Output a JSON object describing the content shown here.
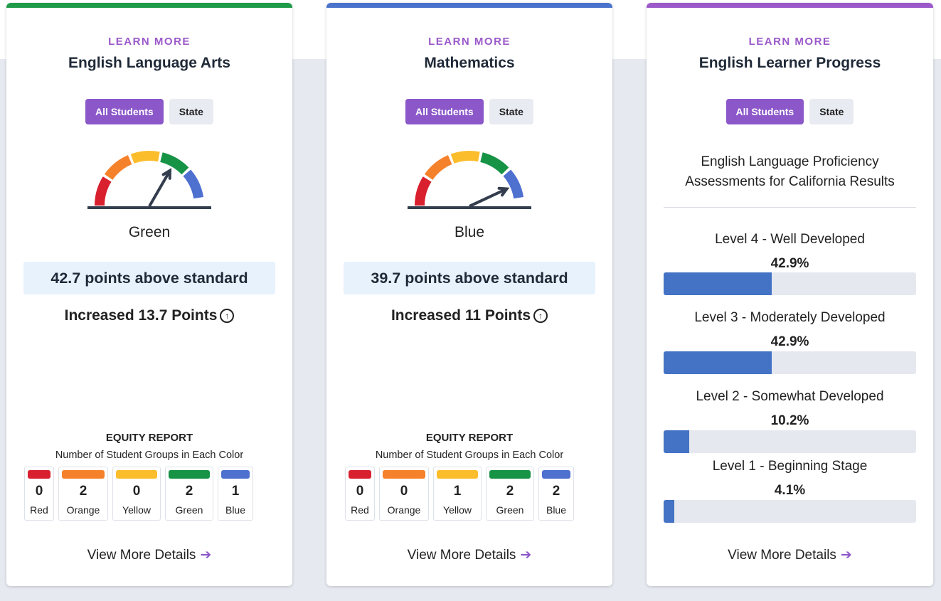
{
  "colors": {
    "ela_accent": "#1e9a48",
    "math_accent": "#4a73cc",
    "elp_accent": "#9b59c9",
    "toggle_active": "#8b57c9",
    "red": "#d8202f",
    "orange": "#f5822b",
    "yellow": "#fbbd2c",
    "green": "#179346",
    "blue": "#4e70cf",
    "progress_fill": "#4472c4"
  },
  "ela": {
    "learn_more": "LEARN MORE",
    "title": "English Language Arts",
    "toggle": {
      "active": "All Students",
      "inactive": "State"
    },
    "status": "Green",
    "gauge_level": "green",
    "points": "42.7 points above standard",
    "change": "Increased 13.7 Points",
    "equity": {
      "title": "EQUITY REPORT",
      "subtitle": "Number of Student Groups in Each Color",
      "cells": [
        {
          "count": "0",
          "label": "Red"
        },
        {
          "count": "2",
          "label": "Orange"
        },
        {
          "count": "0",
          "label": "Yellow"
        },
        {
          "count": "2",
          "label": "Green"
        },
        {
          "count": "1",
          "label": "Blue"
        }
      ]
    },
    "details_link": "View More Details"
  },
  "math": {
    "learn_more": "LEARN MORE",
    "title": "Mathematics",
    "toggle": {
      "active": "All Students",
      "inactive": "State"
    },
    "status": "Blue",
    "gauge_level": "blue",
    "points": "39.7 points above standard",
    "change": "Increased 11 Points",
    "equity": {
      "title": "EQUITY REPORT",
      "subtitle": "Number of Student Groups in Each Color",
      "cells": [
        {
          "count": "0",
          "label": "Red"
        },
        {
          "count": "0",
          "label": "Orange"
        },
        {
          "count": "1",
          "label": "Yellow"
        },
        {
          "count": "2",
          "label": "Green"
        },
        {
          "count": "2",
          "label": "Blue"
        }
      ]
    },
    "details_link": "View More Details"
  },
  "elp": {
    "learn_more": "LEARN MORE",
    "title": "English Learner Progress",
    "toggle": {
      "active": "All Students",
      "inactive": "State"
    },
    "subtitle_line1": "English Language Proficiency",
    "subtitle_line2": "Assessments for California Results",
    "levels": [
      {
        "label": "Level 4 - Well Developed",
        "pct": "42.9%",
        "value": 42.9
      },
      {
        "label": "Level 3 - Moderately Developed",
        "pct": "42.9%",
        "value": 42.9
      },
      {
        "label": "Level 2 - Somewhat Developed",
        "pct": "10.2%",
        "value": 10.2
      },
      {
        "label": "Level 1 - Beginning Stage",
        "pct": "4.1%",
        "value": 4.1
      }
    ],
    "details_link": "View More Details"
  }
}
